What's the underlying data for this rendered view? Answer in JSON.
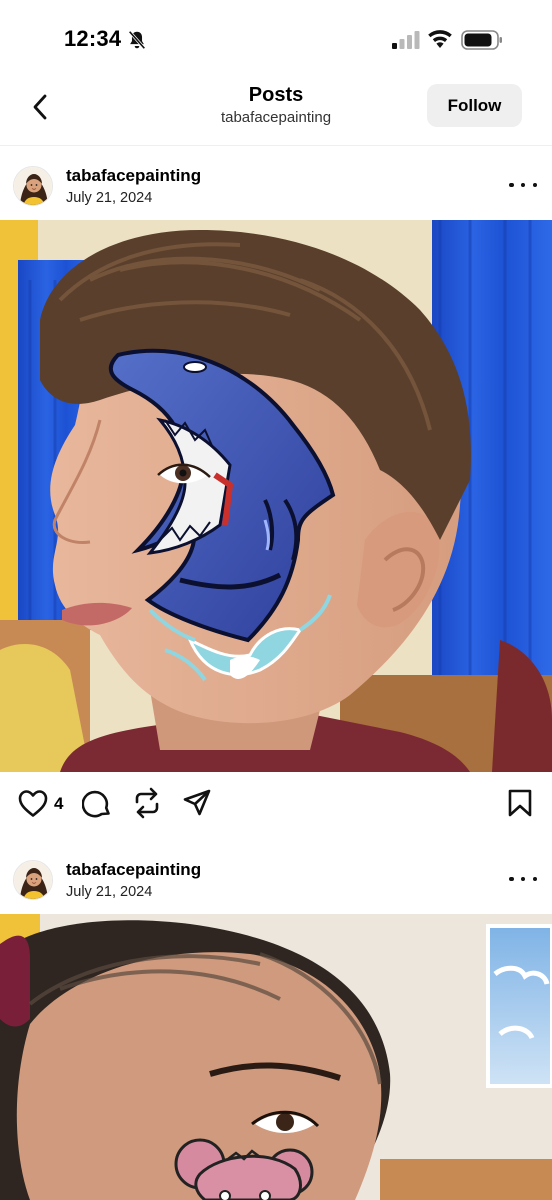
{
  "status_bar": {
    "time": "12:34",
    "icons": [
      "bell-slash-icon",
      "cellular-signal-icon",
      "wifi-icon",
      "battery-icon"
    ]
  },
  "header": {
    "back_icon": "chevron-left-icon",
    "title": "Posts",
    "subtitle": "tabafacepainting",
    "follow_label": "Follow"
  },
  "posts": [
    {
      "username": "tabafacepainting",
      "date": "July 21, 2024",
      "like_count": "4",
      "photo_description_icon": "shark-face-paint-photo",
      "actions": [
        "heart-icon",
        "comment-icon",
        "repost-icon",
        "share-icon",
        "bookmark-icon"
      ]
    },
    {
      "username": "tabafacepainting",
      "date": "July 21, 2024",
      "photo_description_icon": "bear-face-paint-photo"
    }
  ],
  "colors": {
    "follow_bg": "#efefef",
    "text": "#000000",
    "curtain_blue": "#1f56d6",
    "wall_cream": "#efe6c9"
  }
}
